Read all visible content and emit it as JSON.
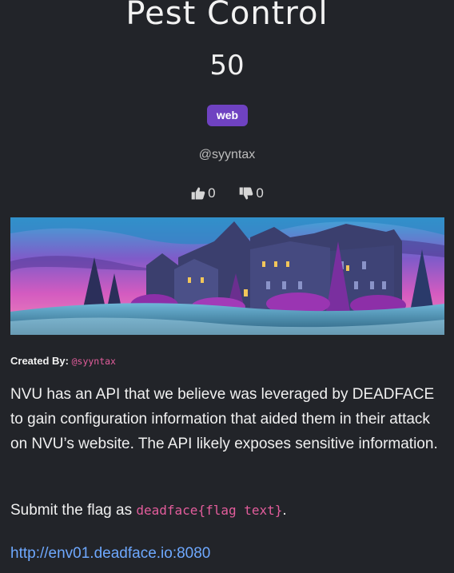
{
  "challenge": {
    "title": "Pest Control",
    "points": "50",
    "category": "web",
    "author_handle": "@syyntax",
    "likes": "0",
    "dislikes": "0"
  },
  "details": {
    "created_by_label": "Created By:",
    "created_by_handle": "@syyntax",
    "description": "NVU has an API that we believe was leveraged by DEADFACE to gain configuration information that aided them in their attack on NVU’s website. The API likely exposes sensitive information.",
    "submit_prefix": "Submit the flag as ",
    "flag_format": "deadface{flag text}",
    "submit_suffix": ".",
    "link": "http://env01.deadface.io:8080"
  },
  "icons": {
    "like": "thumbs-up-icon",
    "dislike": "thumbs-down-icon"
  },
  "colors": {
    "background": "#222429",
    "badge": "#6f42c1",
    "code": "#e35d9c",
    "link": "#6ea8fe"
  }
}
